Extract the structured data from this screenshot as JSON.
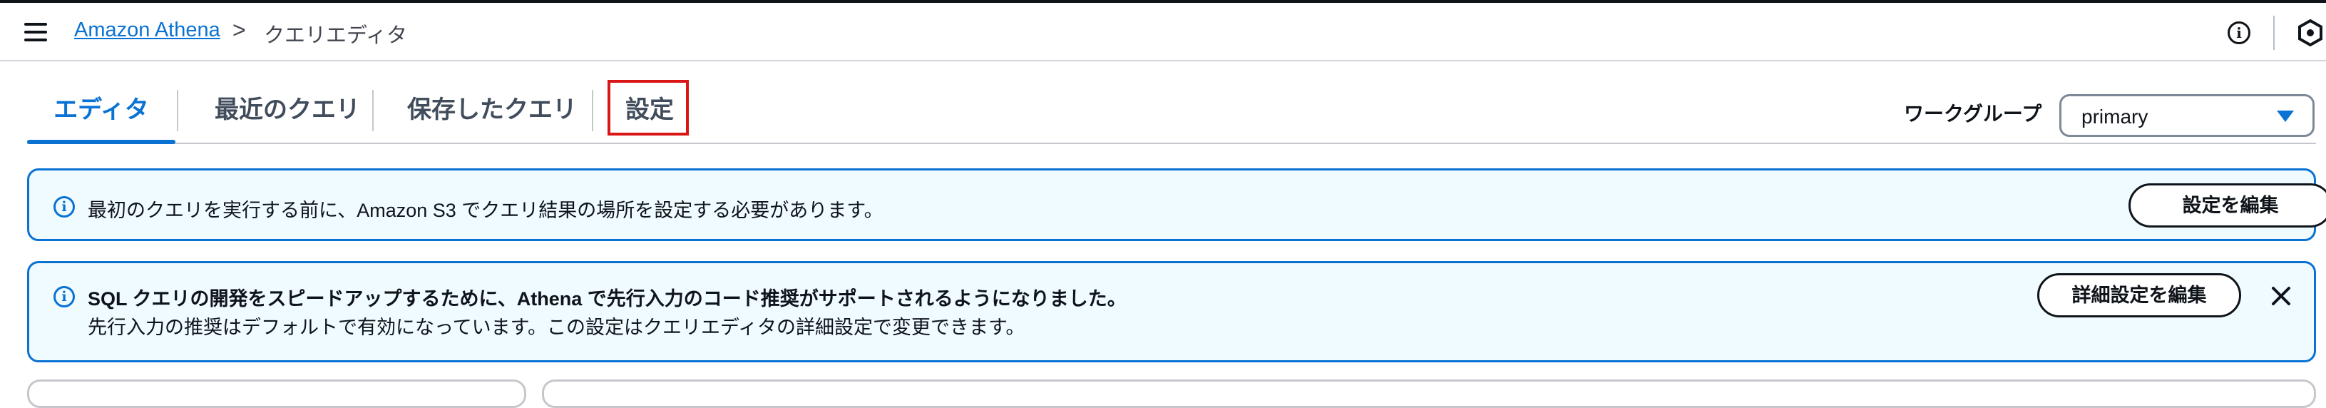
{
  "header": {
    "breadcrumb_link": "Amazon Athena",
    "breadcrumb_separator": ">",
    "breadcrumb_current": "クエリエディタ",
    "info_icon": "info-icon",
    "settings_icon": "settings-hex-icon"
  },
  "tabs": [
    {
      "label": "エディタ",
      "active": true
    },
    {
      "label": "最近のクエリ",
      "active": false
    },
    {
      "label": "保存したクエリ",
      "active": false
    },
    {
      "label": "設定",
      "active": false
    }
  ],
  "workgroup": {
    "label": "ワークグループ",
    "value": "primary"
  },
  "alert_location": {
    "text": "最初のクエリを実行する前に、Amazon S3 でクエリ結果の場所を設定する必要があります。",
    "button": "設定を編集"
  },
  "alert_autocomplete": {
    "title": "SQL クエリの開発をスピードアップするために、Athena で先行入力のコード推奨がサポートされるようになりました。",
    "body": "先行入力の推奨はデフォルトで有効になっています。この設定はクエリエディタの詳細設定で変更できます。",
    "button": "詳細設定を編集"
  },
  "colors": {
    "link": "#0972d3",
    "info_bg": "#f0fbff",
    "highlight": "#d91515"
  }
}
